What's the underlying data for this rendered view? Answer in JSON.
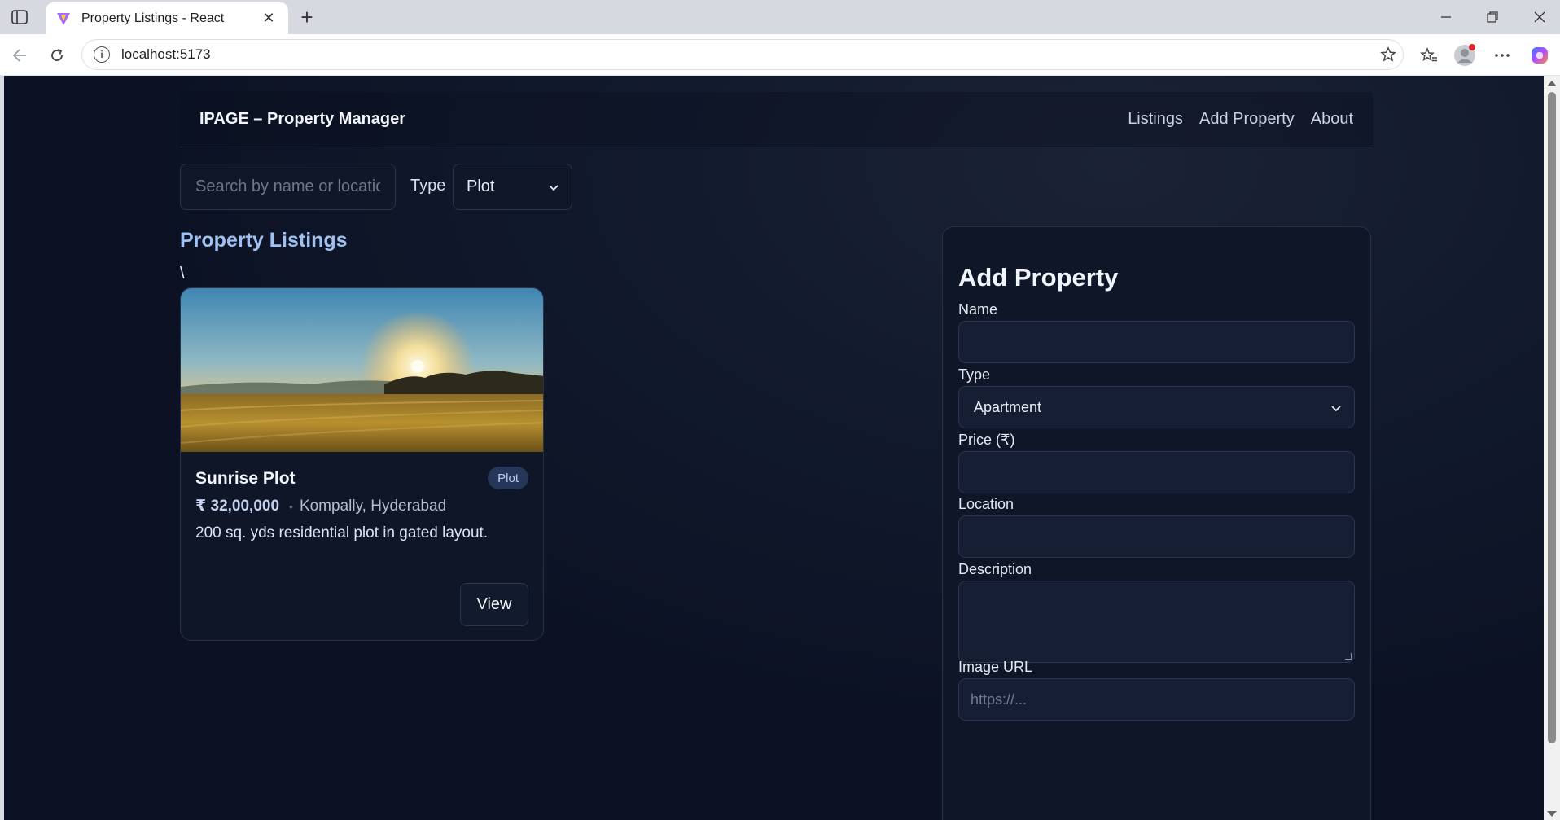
{
  "browser": {
    "tab_title": "Property Listings - React",
    "url": "localhost:5173"
  },
  "app": {
    "brand": "IPAGE – Property Manager",
    "nav": [
      {
        "label": "Listings"
      },
      {
        "label": "Add Property"
      },
      {
        "label": "About"
      }
    ]
  },
  "filters": {
    "search_placeholder": "Search by name or location",
    "type_label": "Type",
    "type_selected": "Plot"
  },
  "listings": {
    "title": "Property Listings",
    "stray_text": "\\",
    "cards": [
      {
        "name": "Sunrise Plot",
        "badge": "Plot",
        "price": "₹ 32,00,000",
        "separator": "•",
        "location": "Kompally, Hyderabad",
        "description": "200 sq. yds residential plot in gated layout.",
        "button": "View"
      }
    ]
  },
  "form": {
    "title": "Add Property",
    "name_label": "Name",
    "name_value": "",
    "type_label": "Type",
    "type_selected": "Apartment",
    "price_label": "Price (₹)",
    "price_value": "",
    "location_label": "Location",
    "location_value": "",
    "description_label": "Description",
    "description_value": "",
    "image_label": "Image URL",
    "image_placeholder": "https://..."
  },
  "colors": {
    "background": "#0c1224",
    "accent_title": "#9fc2f2",
    "badge_bg": "#26355a"
  }
}
